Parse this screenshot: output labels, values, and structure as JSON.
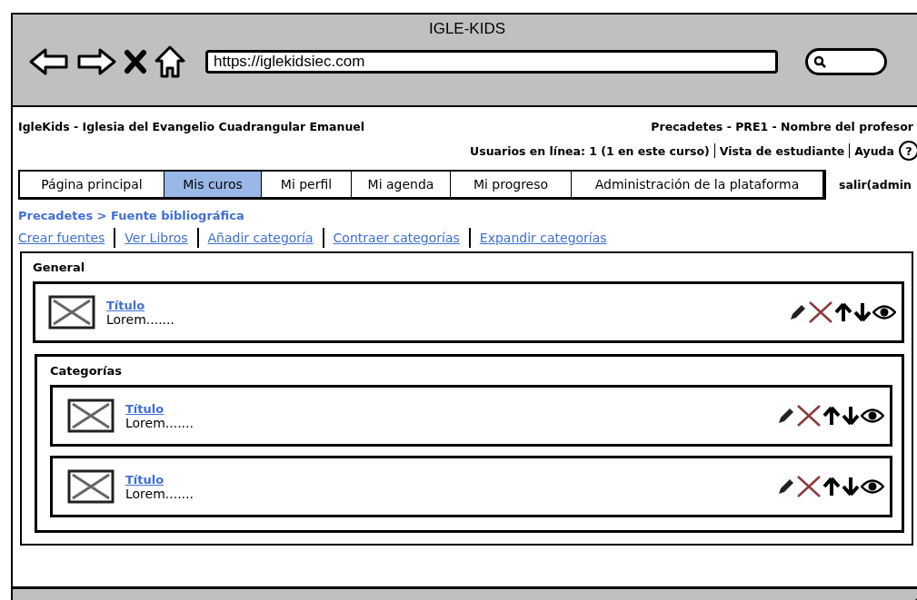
{
  "browser": {
    "title": "IGLE-KIDS",
    "url": "https://iglekidsiec.com"
  },
  "header": {
    "site_name": "IgleKids - Iglesia del Evangelio Cuadrangular Emanuel",
    "course_info": "Precadetes - PRE1 - Nombre del profesor",
    "online_users": "Usuarios en línea: 1 (1 en este curso)",
    "links": [
      "Vista de estudiante",
      "Ayuda"
    ],
    "help_icon": "?"
  },
  "tabs": [
    {
      "label": "Página principal",
      "selected": false
    },
    {
      "label": "Mis curos",
      "selected": true
    },
    {
      "label": "Mi perfil",
      "selected": false
    },
    {
      "label": "Mi agenda",
      "selected": false
    },
    {
      "label": "Mi progreso",
      "selected": false
    },
    {
      "label": "Administración de la plataforma",
      "selected": false
    }
  ],
  "logout": "salir(admin",
  "breadcrumb": "Precadetes > Fuente bibliográfica",
  "actions": [
    "Crear fuentes",
    "Ver Libros",
    "Añadir categoría",
    "Contraer categorías",
    "Expandir categorías"
  ],
  "panel": {
    "title": "General",
    "items": [
      {
        "title": "Título",
        "text": "Lorem......."
      }
    ],
    "groups": [
      {
        "title": "Categorías",
        "items": [
          {
            "title": "Título",
            "text": "Lorem......."
          },
          {
            "title": "Título",
            "text": "Lorem......."
          }
        ]
      }
    ]
  }
}
